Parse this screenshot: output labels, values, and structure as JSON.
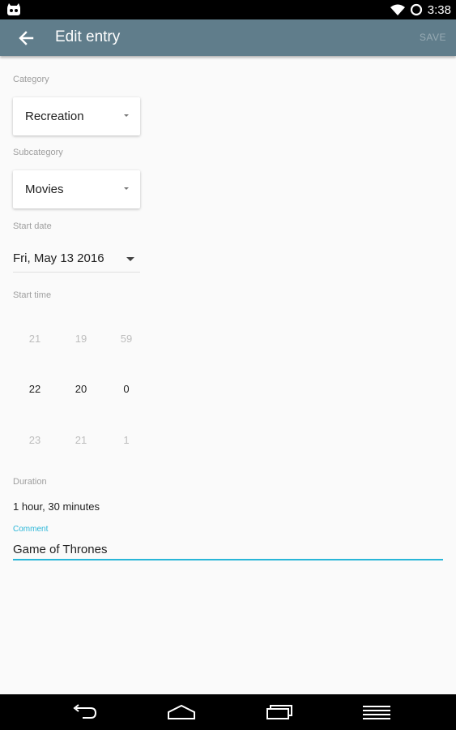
{
  "status_bar": {
    "time": "3:38"
  },
  "toolbar": {
    "title": "Edit entry",
    "save_label": "SAVE"
  },
  "form": {
    "category_label": "Category",
    "category_value": "Recreation",
    "subcategory_label": "Subcategory",
    "subcategory_value": "Movies",
    "start_date_label": "Start date",
    "start_date_value": "Fri, May 13 2016",
    "start_time_label": "Start time",
    "time_picker": {
      "hour": {
        "prev": "21",
        "current": "22",
        "next": "23"
      },
      "minute": {
        "prev": "19",
        "current": "20",
        "next": "21"
      },
      "second": {
        "prev": "59",
        "current": "0",
        "next": "1"
      }
    },
    "duration_label": "Duration",
    "duration_value": "1 hour, 30 minutes",
    "comment_label": "Comment",
    "comment_value": "Game of Thrones"
  },
  "icons": {
    "status": [
      "app-notification-icon",
      "wifi-icon",
      "battery-icon"
    ],
    "toolbar": "back-arrow-icon",
    "nav": [
      "back-icon",
      "home-icon",
      "recents-icon",
      "menu-icon"
    ]
  },
  "colors": {
    "toolbar": "#607d8b",
    "accent": "#29b6d8"
  }
}
